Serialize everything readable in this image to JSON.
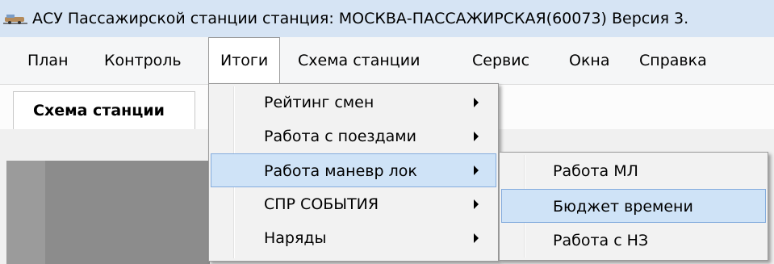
{
  "window": {
    "title": "АСУ Пассажирской станции станция: МОСКВА-ПАССАЖИРСКАЯ(60073)  Версия 3."
  },
  "menubar": {
    "items": [
      {
        "label": "План"
      },
      {
        "label": "Контроль"
      },
      {
        "label": "Итоги"
      },
      {
        "label": "Схема станции"
      },
      {
        "label": "Сервис"
      },
      {
        "label": "Окна"
      },
      {
        "label": "Справка"
      }
    ],
    "active_index": 2
  },
  "tabs": [
    {
      "label": "Схема станции"
    }
  ],
  "itogi_menu": {
    "items": [
      {
        "label": "Рейтинг смен"
      },
      {
        "label": "Работа с поездами"
      },
      {
        "label": "Работа маневр лок"
      },
      {
        "label": "СПР СОБЫТИЯ"
      },
      {
        "label": "Наряды"
      }
    ],
    "highlighted_index": 2
  },
  "submenu": {
    "items": [
      {
        "label": "Работа МЛ"
      },
      {
        "label": "Бюджет времени"
      },
      {
        "label": "Работа с НЗ"
      }
    ],
    "highlighted_index": 1
  },
  "colors": {
    "titlebar": "#d6e4f4",
    "highlight": "#cfe3f7",
    "highlight_border": "#84acdd"
  }
}
